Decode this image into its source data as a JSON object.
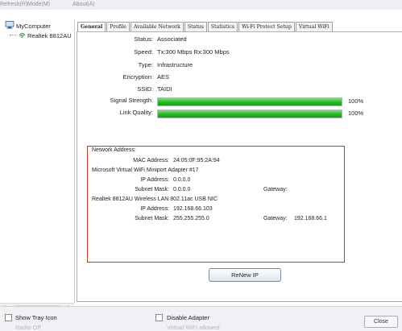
{
  "menu": [
    "Refresh(R)",
    "Mode(M)",
    "About(A)"
  ],
  "tree": {
    "root": "MyComputer",
    "child": "Realtek 8812AU"
  },
  "tabs": [
    "General",
    "Profile",
    "Available Network",
    "Status",
    "Statistics",
    "Wi-Fi Protect Setup",
    "Virtual WiFi"
  ],
  "general": {
    "status_label": "Status:",
    "status": "Associated",
    "speed_label": "Speed:",
    "speed": "Tx:300 Mbps Rx:300 Mbps",
    "type_label": "Type:",
    "type": "Infrastructure",
    "encryption_label": "Encryption:",
    "encryption": "AES",
    "ssid_label": "SSID:",
    "ssid": "TAIDI",
    "signal_label": "Signal Strength:",
    "signal_pct": "100%",
    "signal_fraction": 1.0,
    "link_label": "Link Quality:",
    "link_pct": "100%",
    "link_fraction": 1.0
  },
  "network": {
    "title": "Network Address:",
    "mac_label": "MAC Address:",
    "mac": "24:05:0F:95:2A:94",
    "adapter1": "Microsoft Virtual WiFi Miniport Adapter #17",
    "ip1_label": "IP Address:",
    "ip1": "0.0.0.0",
    "mask1_label": "Subnet Mask:",
    "mask1": "0.0.0.0",
    "gw1_label": "Gateway:",
    "gw1": "",
    "adapter2": "Realtek 8812AU Wireless LAN 802.11ac USB NIC",
    "ip2_label": "IP Address:",
    "ip2": "192.168.66.103",
    "mask2_label": "Subnet Mask:",
    "mask2": "255.255.255.0",
    "gw2_label": "Gateway:",
    "gw2": "192.168.66.1"
  },
  "renew_label": "ReNew IP",
  "bottom": {
    "show_tray": "Show Tray Icon",
    "radio_off": "Radio Off",
    "disable_adapter": "Disable Adapter",
    "virtual_wifi": "Virtual WiFi allowed",
    "close": "Close"
  },
  "colors": {
    "bar_green": "#25b825",
    "box_red": "#c0392b"
  }
}
